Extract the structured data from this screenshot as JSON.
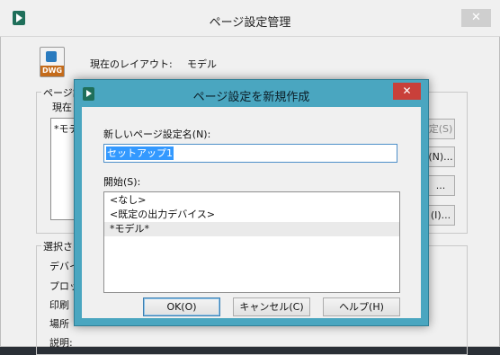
{
  "background_window": {
    "title": "ページ設定管理",
    "close_glyph": "✕",
    "current_layout_label": "現在のレイアウト:",
    "current_layout_value": "モデル",
    "page_setup_group_label": "ページ設",
    "current_label": "現在",
    "list_item_partial": "*モデ",
    "buttons": {
      "set_current": "定(S)",
      "new": "(N)...",
      "modify": "...",
      "import": "(I)..."
    },
    "selection_group_label": "選択さ",
    "details_labels": [
      "デバイ",
      "プロッ",
      "印刷",
      "場所",
      "説明:"
    ]
  },
  "dialog": {
    "title": "ページ設定を新規作成",
    "close_glyph": "✕",
    "name_label": "新しいページ設定名(N):",
    "name_value": "セットアップ1",
    "start_label": "開始(S):",
    "start_options": [
      "<なし>",
      "<既定の出力デバイス>",
      "*モデル*"
    ],
    "selected_option_index": 2,
    "ok_label": "OK(O)",
    "cancel_label": "キャンセル(C)",
    "help_label": "ヘルプ(H)"
  },
  "icons": {
    "dwg_badge": "DWG"
  }
}
